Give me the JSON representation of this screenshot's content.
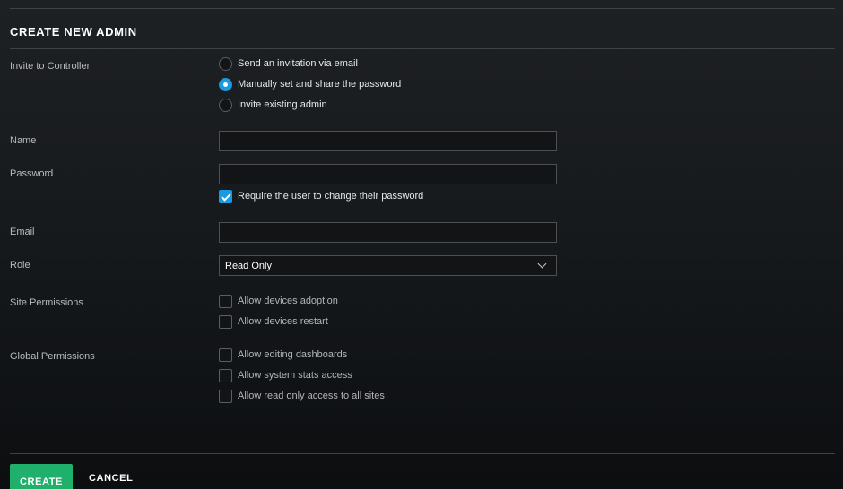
{
  "title": "CREATE NEW ADMIN",
  "invite": {
    "label": "Invite to Controller",
    "options": [
      {
        "label": "Send an invitation via email",
        "selected": false
      },
      {
        "label": "Manually set and share the password",
        "selected": true
      },
      {
        "label": "Invite existing admin",
        "selected": false
      }
    ]
  },
  "name": {
    "label": "Name",
    "value": ""
  },
  "password": {
    "label": "Password",
    "value": "",
    "require_change": {
      "label": "Require the user to change their password",
      "checked": true
    }
  },
  "email": {
    "label": "Email",
    "value": ""
  },
  "role": {
    "label": "Role",
    "value": "Read Only"
  },
  "site_permissions": {
    "label": "Site Permissions",
    "options": [
      {
        "label": "Allow devices adoption",
        "checked": false
      },
      {
        "label": "Allow devices restart",
        "checked": false
      }
    ]
  },
  "global_permissions": {
    "label": "Global Permissions",
    "options": [
      {
        "label": "Allow editing dashboards",
        "checked": false
      },
      {
        "label": "Allow system stats access",
        "checked": false
      },
      {
        "label": "Allow read only access to all sites",
        "checked": false
      }
    ]
  },
  "actions": {
    "create_label": "CREATE",
    "cancel_label": "CANCEL"
  },
  "colors": {
    "accent": "#1a9ae0",
    "create": "#1fb16b",
    "background": "#16191c"
  }
}
